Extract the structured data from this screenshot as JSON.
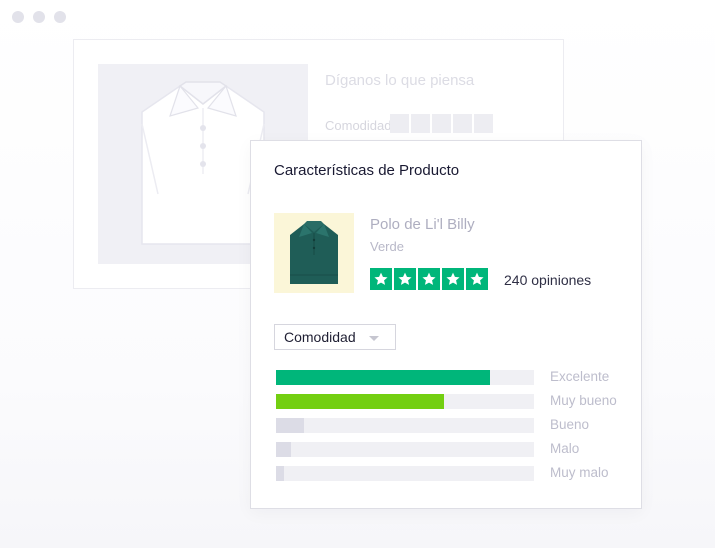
{
  "colors": {
    "star_green": "#00b67a",
    "bar_excellent": "#00b67a",
    "bar_very_good": "#73cf11",
    "bar_muted": "#dcdce6",
    "track": "#f0f0f4"
  },
  "background_card": {
    "title": "Díganos lo que piensa",
    "rating_label": "Comodidad",
    "image_icon": "white-polo-shirt"
  },
  "product_card": {
    "title": "Características de Producto",
    "product_name": "Polo de Li'l Billy",
    "variant": "Verde",
    "rating_stars": 5,
    "review_count_text": "240 opiniones",
    "image_icon": "green-polo-shirt",
    "category_dropdown": {
      "selected": "Comodidad",
      "icon": "caret-down-icon"
    },
    "ratings": [
      {
        "label": "Excelente",
        "fraction": 0.83,
        "color": "#00b67a"
      },
      {
        "label": "Muy bueno",
        "fraction": 0.65,
        "color": "#73cf11"
      },
      {
        "label": "Bueno",
        "fraction": 0.11,
        "color": "#dcdce6"
      },
      {
        "label": "Malo",
        "fraction": 0.06,
        "color": "#dcdce6"
      },
      {
        "label": "Muy malo",
        "fraction": 0.03,
        "color": "#dcdce6"
      }
    ]
  }
}
